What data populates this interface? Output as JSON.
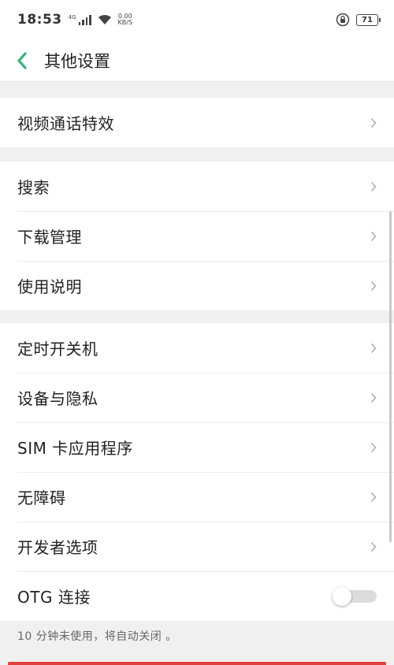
{
  "status_bar": {
    "time": "18:53",
    "network_tag": "4G",
    "speed_value": "0.00",
    "speed_unit": "KB/S",
    "battery": "71"
  },
  "header": {
    "title": "其他设置",
    "back_icon": "chevron-left-icon",
    "accent_color": "#3db37a"
  },
  "groups": [
    {
      "items": [
        {
          "label": "视频通话特效"
        }
      ]
    },
    {
      "items": [
        {
          "label": "搜索"
        },
        {
          "label": "下载管理"
        },
        {
          "label": "使用说明"
        }
      ]
    },
    {
      "items": [
        {
          "label": "定时开关机"
        },
        {
          "label": "设备与隐私"
        },
        {
          "label": "SIM 卡应用程序"
        },
        {
          "label": "无障碍"
        },
        {
          "label": "开发者选项"
        },
        {
          "label": "OTG 连接",
          "toggle": false
        }
      ]
    }
  ],
  "footnote": "10 分钟未使用，将自动关闭 。",
  "bottom_bar_color": "#e04040"
}
